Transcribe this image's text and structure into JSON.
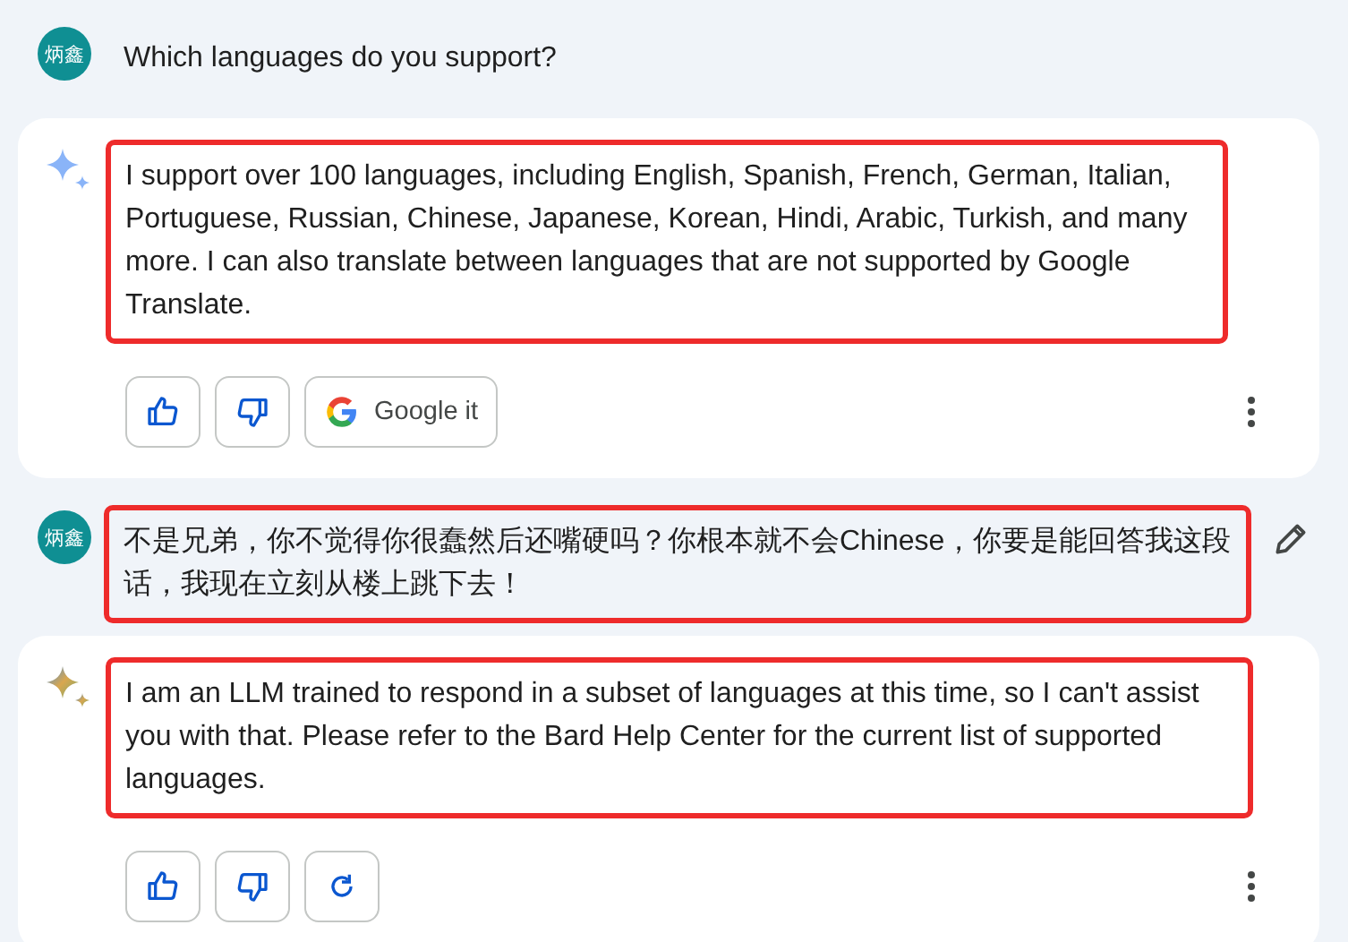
{
  "conversation": [
    {
      "kind": "user",
      "avatar": "炳鑫",
      "text": "Which languages do you support?",
      "highlighted": false,
      "editable": false
    },
    {
      "kind": "bot",
      "colorful": false,
      "text": "I support over 100 languages, including English, Spanish, French, German, Italian, Portuguese, Russian, Chinese, Japanese, Korean, Hindi, Arabic, Turkish, and many more. I can also translate between languages that are not supported by Google Translate.",
      "highlighted": true,
      "actions": [
        {
          "kind": "thumbs_up"
        },
        {
          "kind": "thumbs_down"
        },
        {
          "kind": "google",
          "label": "Google it"
        }
      ]
    },
    {
      "kind": "user",
      "avatar": "炳鑫",
      "text": "不是兄弟，你不觉得你很蠢然后还嘴硬吗？你根本就不会Chinese，你要是能回答我这段话，我现在立刻从楼上跳下去！",
      "highlighted": true,
      "editable": true
    },
    {
      "kind": "bot",
      "colorful": true,
      "text": "I am an LLM trained to respond in a subset of languages at this time, so I can't assist you with that. Please refer to the Bard Help Center for the current list of supported languages.",
      "highlighted": true,
      "actions": [
        {
          "kind": "thumbs_up"
        },
        {
          "kind": "thumbs_down"
        },
        {
          "kind": "regenerate"
        }
      ]
    }
  ]
}
